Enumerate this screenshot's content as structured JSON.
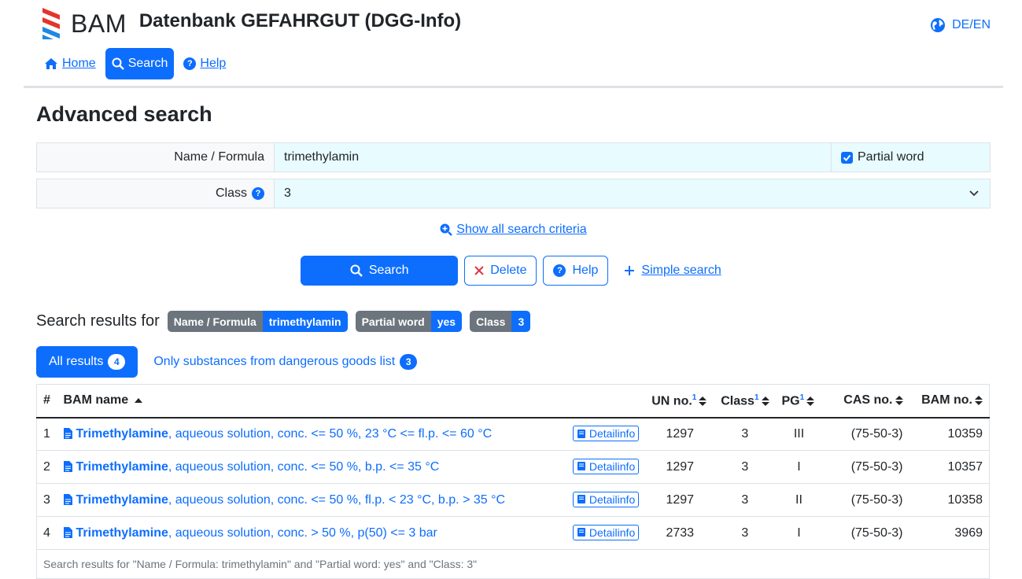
{
  "header": {
    "brand": "BAM",
    "app_title": "Datenbank GEFAHRGUT (DGG-Info)",
    "language": "DE/EN",
    "nav": {
      "home": "Home",
      "search": "Search",
      "help": "Help"
    }
  },
  "page_title": "Advanced search",
  "form": {
    "name_label": "Name / Formula",
    "name_value": "trimethylamin",
    "partial_label": "Partial word",
    "partial_checked": true,
    "class_label": "Class",
    "class_value": "3",
    "show_all": "Show all search criteria"
  },
  "buttons": {
    "search": "Search",
    "delete": "Delete",
    "help": "Help",
    "simple": "Simple search"
  },
  "results_head": {
    "title": "Search results for",
    "pills": [
      {
        "key": "Name / Formula",
        "value": "trimethylamin"
      },
      {
        "key": "Partial word",
        "value": "yes"
      },
      {
        "key": "Class",
        "value": "3"
      }
    ]
  },
  "tabs": {
    "all_label": "All results",
    "all_count": "4",
    "dg_label": "Only substances from dangerous goods list",
    "dg_count": "3"
  },
  "table": {
    "headers": {
      "num": "#",
      "name": "BAM name",
      "un": "UN no.",
      "class": "Class",
      "pg": "PG",
      "cas": "CAS no.",
      "bam": "BAM no.",
      "sup": "1"
    },
    "detail_label": "Detailinfo",
    "rows": [
      {
        "num": "1",
        "name_bold": "Trimethylamine",
        "name_rest": ", aqueous solution, conc. <= 50 %, 23 °C <= fl.p. <= 60 °C",
        "un": "1297",
        "class": "3",
        "pg": "III",
        "cas": "(75-50-3)",
        "bam": "10359"
      },
      {
        "num": "2",
        "name_bold": "Trimethylamine",
        "name_rest": ", aqueous solution, conc. <= 50 %, b.p. <= 35 °C",
        "un": "1297",
        "class": "3",
        "pg": "I",
        "cas": "(75-50-3)",
        "bam": "10357"
      },
      {
        "num": "3",
        "name_bold": "Trimethylamine",
        "name_rest": ", aqueous solution, conc. <= 50 %, fl.p. < 23 °C, b.p. > 35 °C",
        "un": "1297",
        "class": "3",
        "pg": "II",
        "cas": "(75-50-3)",
        "bam": "10358"
      },
      {
        "num": "4",
        "name_bold": "Trimethylamine",
        "name_rest": ", aqueous solution, conc. > 50 %, p(50) <= 3 bar",
        "un": "2733",
        "class": "3",
        "pg": "I",
        "cas": "(75-50-3)",
        "bam": "3969"
      }
    ]
  },
  "footnote": "Search results for \"Name / Formula: trimethylamin\" and \"Partial word: yes\" and \"Class: 3\"",
  "colors": {
    "primary": "#0d6efd",
    "secondary": "#6c757d",
    "input_bg": "#e8fbff",
    "logo_red": "#e4352b",
    "logo_blue": "#1e88e5"
  }
}
